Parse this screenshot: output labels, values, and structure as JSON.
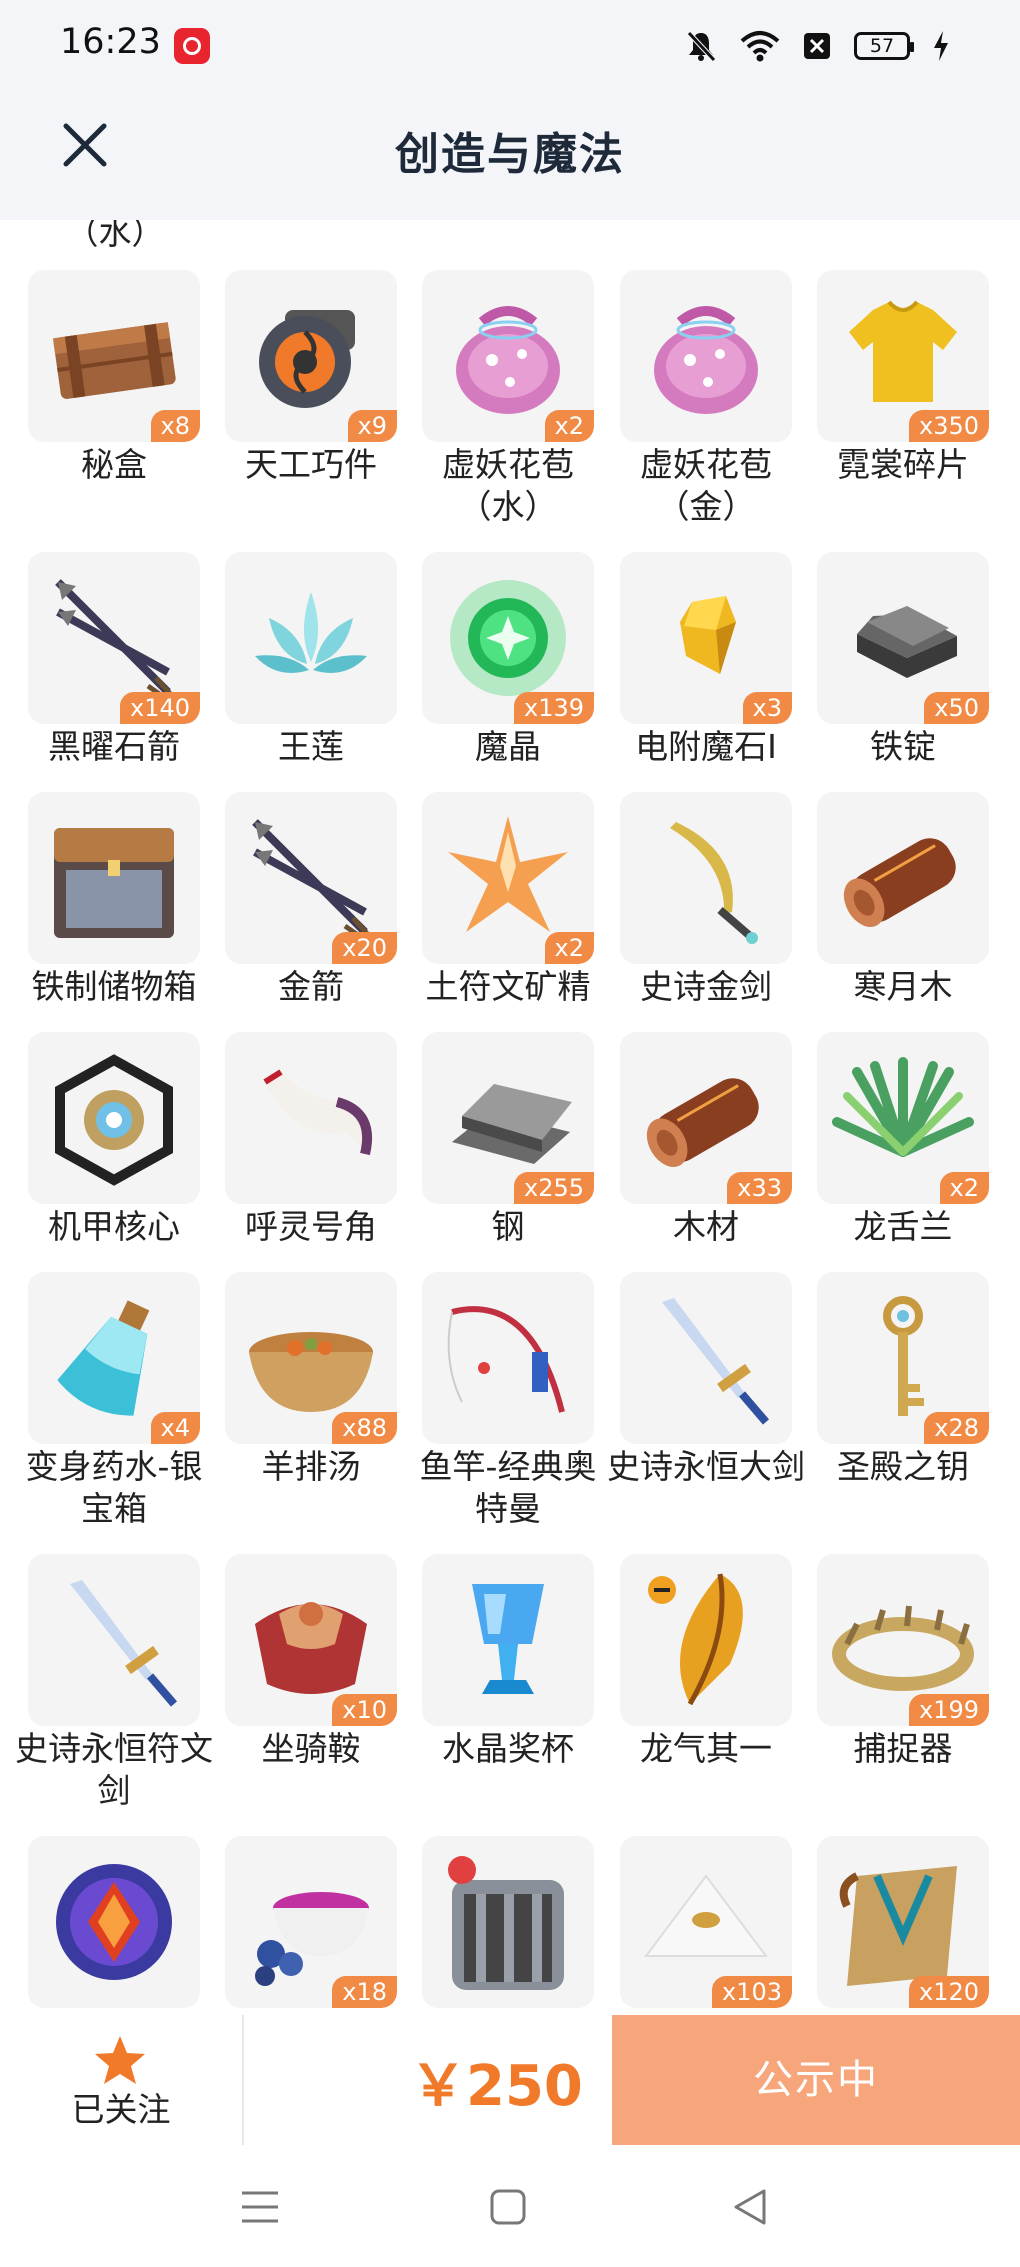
{
  "status_bar": {
    "time": "16:23",
    "battery": "57"
  },
  "header": {
    "title": "创造与魔法"
  },
  "partial_label": "（水）",
  "grid": {
    "rows": [
      [
        {
          "name": "秘盒",
          "count": "x8",
          "icon": "wooden-crate-icon"
        },
        {
          "name": "天工巧件",
          "count": "x9",
          "icon": "gear-core-icon"
        },
        {
          "name": "虚妖花苞（水）",
          "count": "x2",
          "icon": "flower-bud-icon"
        },
        {
          "name": "虚妖花苞（金）",
          "count": "",
          "icon": "flower-bud-icon"
        },
        {
          "name": "霓裳碎片",
          "count": "x350",
          "icon": "shirt-icon"
        }
      ],
      [
        {
          "name": "黑曜石箭",
          "count": "x140",
          "icon": "arrows-icon"
        },
        {
          "name": "王莲",
          "count": "",
          "icon": "lotus-icon"
        },
        {
          "name": "魔晶",
          "count": "x139",
          "icon": "magic-crystal-icon"
        },
        {
          "name": "电附魔石I",
          "count": "x3",
          "icon": "gem-icon"
        },
        {
          "name": "铁锭",
          "count": "x50",
          "icon": "iron-ingot-icon"
        }
      ],
      [
        {
          "name": "铁制储物箱",
          "count": "",
          "icon": "storage-box-icon"
        },
        {
          "name": "金箭",
          "count": "x20",
          "icon": "arrows-icon"
        },
        {
          "name": "土符文矿精",
          "count": "x2",
          "icon": "crystal-star-icon"
        },
        {
          "name": "史诗金剑",
          "count": "",
          "icon": "curved-sword-icon"
        },
        {
          "name": "寒月木",
          "count": "",
          "icon": "log-icon"
        }
      ],
      [
        {
          "name": "机甲核心",
          "count": "",
          "icon": "mech-core-icon"
        },
        {
          "name": "呼灵号角",
          "count": "",
          "icon": "horn-icon"
        },
        {
          "name": "钢",
          "count": "x255",
          "icon": "steel-icon"
        },
        {
          "name": "木材",
          "count": "x33",
          "icon": "log-icon"
        },
        {
          "name": "龙舌兰",
          "count": "x2",
          "icon": "agave-icon"
        }
      ],
      [
        {
          "name": "变身药水-银宝箱",
          "count": "x4",
          "icon": "potion-icon"
        },
        {
          "name": "羊排汤",
          "count": "x88",
          "icon": "soup-bowl-icon"
        },
        {
          "name": "鱼竿-经典奥特曼",
          "count": "",
          "icon": "fishing-rod-icon"
        },
        {
          "name": "史诗永恒大剑",
          "count": "",
          "icon": "sword-icon"
        },
        {
          "name": "圣殿之钥",
          "count": "x28",
          "icon": "key-icon"
        }
      ],
      [
        {
          "name": "史诗永恒符文剑",
          "count": "",
          "icon": "sword-icon"
        },
        {
          "name": "坐骑鞍",
          "count": "x10",
          "icon": "saddle-icon"
        },
        {
          "name": "水晶奖杯",
          "count": "",
          "icon": "trophy-icon"
        },
        {
          "name": "龙气其一",
          "count": "",
          "icon": "feather-icon"
        },
        {
          "name": "捕捉器",
          "count": "x199",
          "icon": "trap-icon"
        }
      ],
      [
        {
          "name": "",
          "count": "",
          "icon": "amulet-icon"
        },
        {
          "name": "",
          "count": "x18",
          "icon": "berry-bowl-icon"
        },
        {
          "name": "",
          "count": "",
          "icon": "pet-cage-icon"
        },
        {
          "name": "",
          "count": "x103",
          "icon": "pyramid-icon"
        },
        {
          "name": "",
          "count": "x120",
          "icon": "scroll-icon"
        }
      ]
    ]
  },
  "action_bar": {
    "follow_label": "已关注",
    "price": "￥250",
    "cta_label": "公示中",
    "colors": {
      "accent": "#f07a2a",
      "cta": "#f7a67c",
      "badge": "#f08a45"
    }
  }
}
